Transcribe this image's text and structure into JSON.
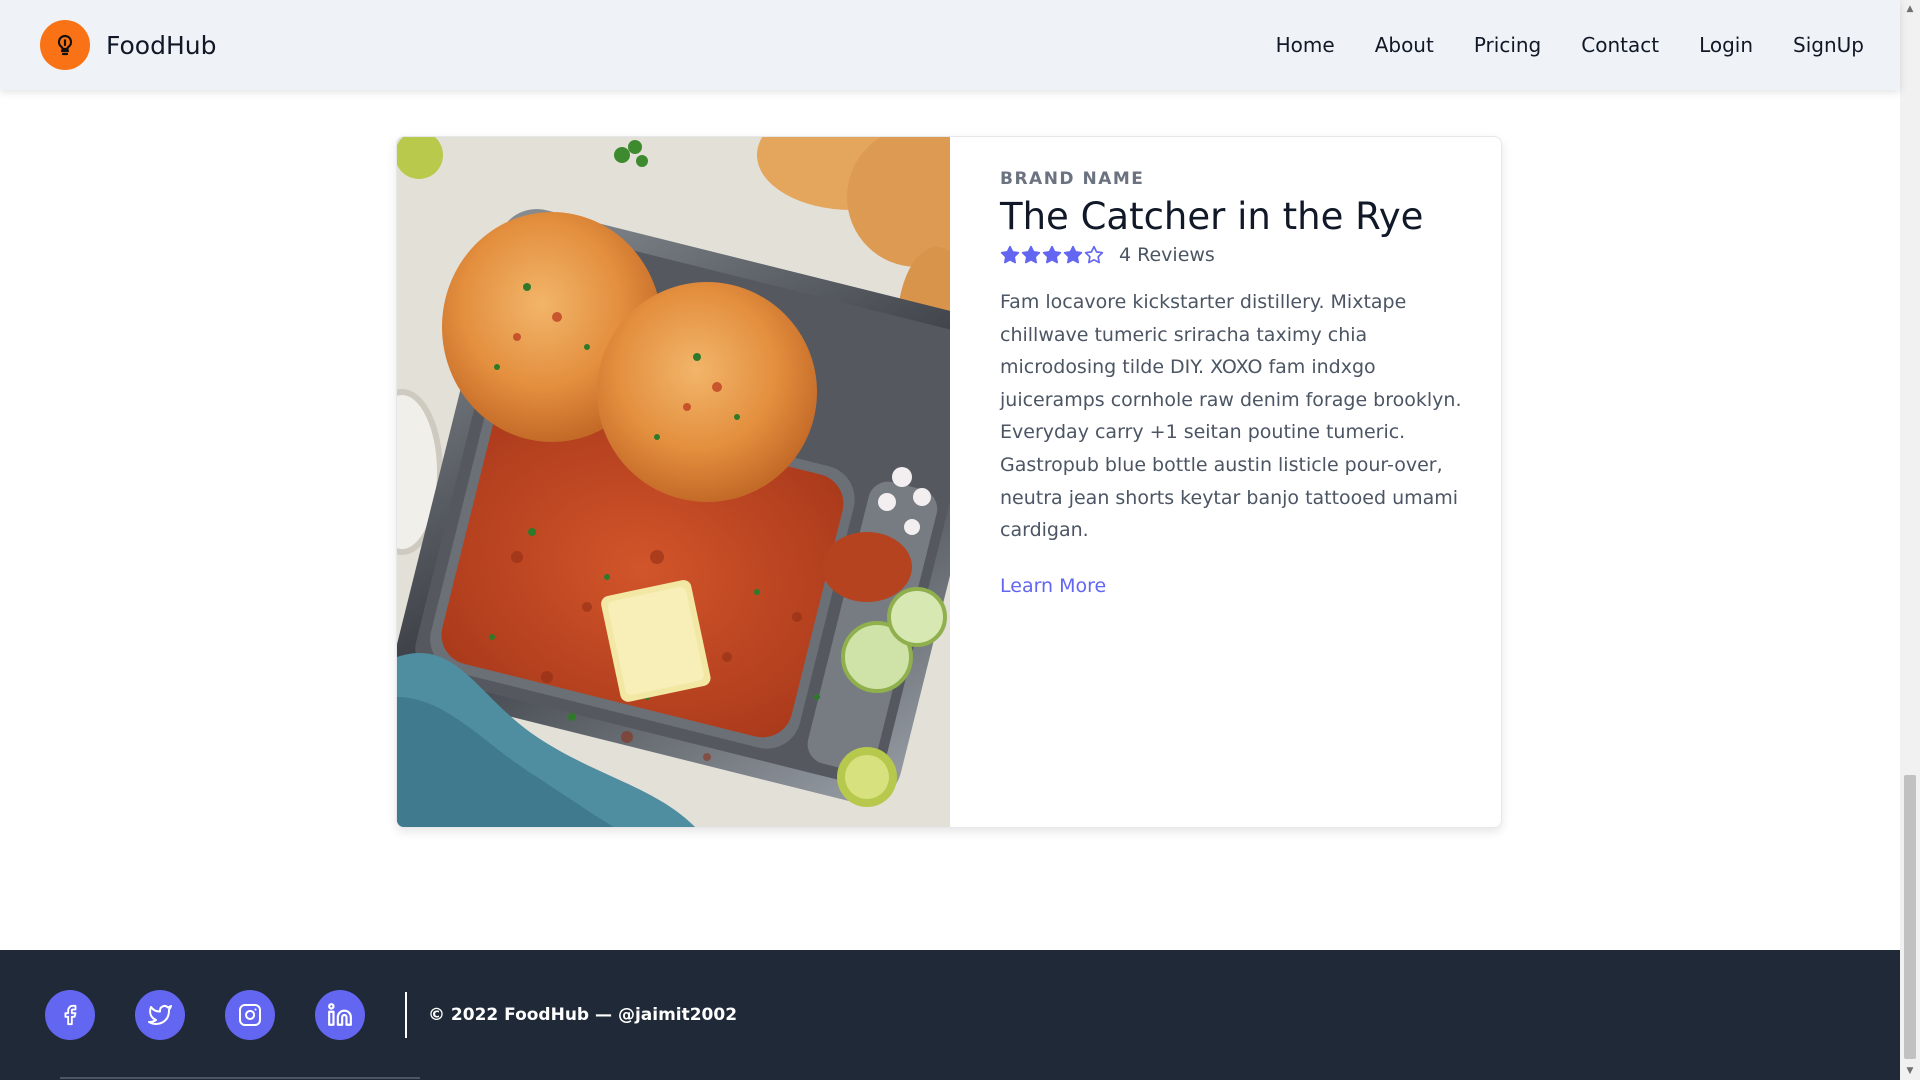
{
  "header": {
    "brand_name": "FoodHub",
    "logo_icon": "lightbulb-icon",
    "nav": [
      "Home",
      "About",
      "Pricing",
      "Contact",
      "Login",
      "SignUp"
    ]
  },
  "product": {
    "brand_label": "BRAND NAME",
    "title": "The Catcher in the Rye",
    "rating": 4,
    "rating_max": 5,
    "reviews_text": "4 Reviews",
    "description": "Fam locavore kickstarter distillery. Mixtape chillwave tumeric sriracha taximy chia microdosing tilde DIY. XOXO fam indxgo juiceramps cornhole raw denim forage brooklyn. Everyday carry +1 seitan poutine tumeric. Gastropub blue bottle austin listicle pour-over, neutra jean shorts keytar banjo tattooed umami cardigan.",
    "learn_more": "Learn More"
  },
  "footer": {
    "socials": [
      "facebook-icon",
      "twitter-icon",
      "instagram-icon",
      "linkedin-icon"
    ],
    "copyright": "© 2022 FoodHub — @jaimit2002"
  },
  "colors": {
    "accent": "#6366f1",
    "brand_orange": "#f97316",
    "footer_bg": "#1f2937",
    "header_bg": "#eff3f7"
  }
}
